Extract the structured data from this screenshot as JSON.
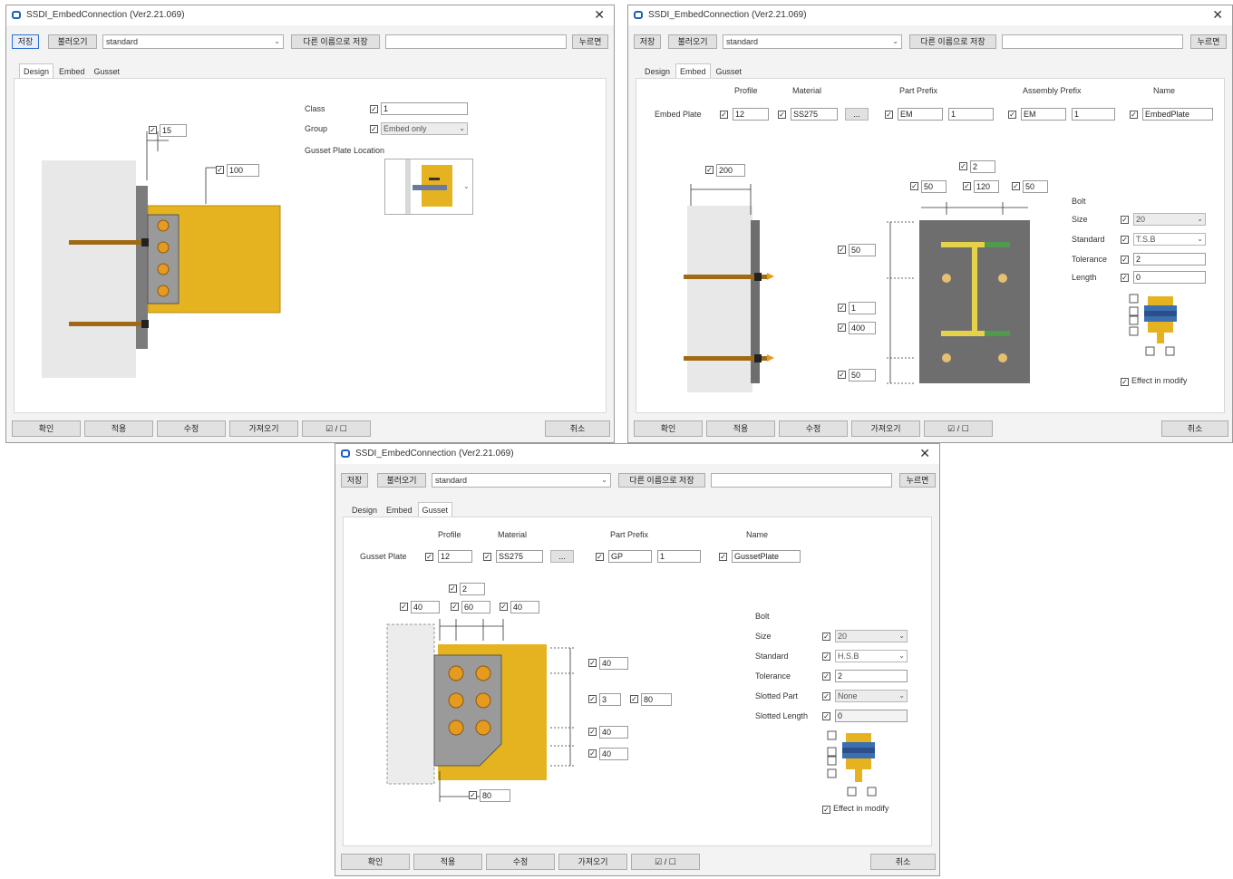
{
  "common": {
    "title": "SSDI_EmbedConnection (Ver2.21.069)",
    "toolbar": {
      "save": "저장",
      "load": "불러오기",
      "preset": "standard",
      "save_other": "다른 이름으로 저장",
      "name_input": "",
      "new": "누르면"
    },
    "tabs": [
      "Design",
      "Embed",
      "Gusset"
    ],
    "bottom": {
      "ok": "확인",
      "apply": "적용",
      "modify": "수정",
      "get": "가져오기",
      "check": "☑ / ☐",
      "cancel": "취소"
    }
  },
  "design": {
    "class_label": "Class",
    "class_value": "1",
    "group_label": "Group",
    "group_value": "Embed only",
    "gusset_loc_label": "Gusset Plate Location",
    "dim_top": "15",
    "dim_offset": "100"
  },
  "embed": {
    "headers": {
      "profile": "Profile",
      "material": "Material",
      "part_prefix": "Part Prefix",
      "assembly_prefix": "Assembly Prefix",
      "name": "Name"
    },
    "row_label": "Embed Plate",
    "profile": "12",
    "material": "SS275",
    "part_prefix": "EM",
    "part_start": "1",
    "assembly_prefix": "EM",
    "assembly_start": "1",
    "name": "EmbedPlate",
    "dims": {
      "width_top": "200",
      "count": "2",
      "edge_left": "50",
      "spacing": "120",
      "edge_right": "50",
      "top": "50",
      "rows": "1",
      "pitch": "400",
      "bottom": "50"
    },
    "bolt": {
      "title": "Bolt",
      "size_label": "Size",
      "size": "20",
      "standard_label": "Standard",
      "standard": "T.S.B",
      "tolerance_label": "Tolerance",
      "tolerance": "2",
      "length_label": "Length",
      "length": "0"
    },
    "effect_label": "Effect in modify"
  },
  "gusset": {
    "headers": {
      "profile": "Profile",
      "material": "Material",
      "part_prefix": "Part Prefix",
      "name": "Name"
    },
    "row_label": "Gusset Plate",
    "profile": "12",
    "material": "SS275",
    "part_prefix": "GP",
    "part_start": "1",
    "name": "GussetPlate",
    "dims": {
      "count": "2",
      "left": "40",
      "spacing": "60",
      "right": "40",
      "top": "40",
      "rows": "3",
      "pitch": "80",
      "row_gap": "40",
      "bottom": "40",
      "chamfer": "80"
    },
    "bolt": {
      "title": "Bolt",
      "size_label": "Size",
      "size": "20",
      "standard_label": "Standard",
      "standard": "H.S.B",
      "tolerance_label": "Tolerance",
      "tolerance": "2",
      "slotted_part_label": "Slotted Part",
      "slotted_part": "None",
      "slotted_length_label": "Slotted Length",
      "slotted_length": "0"
    },
    "effect_label": "Effect in modify"
  }
}
